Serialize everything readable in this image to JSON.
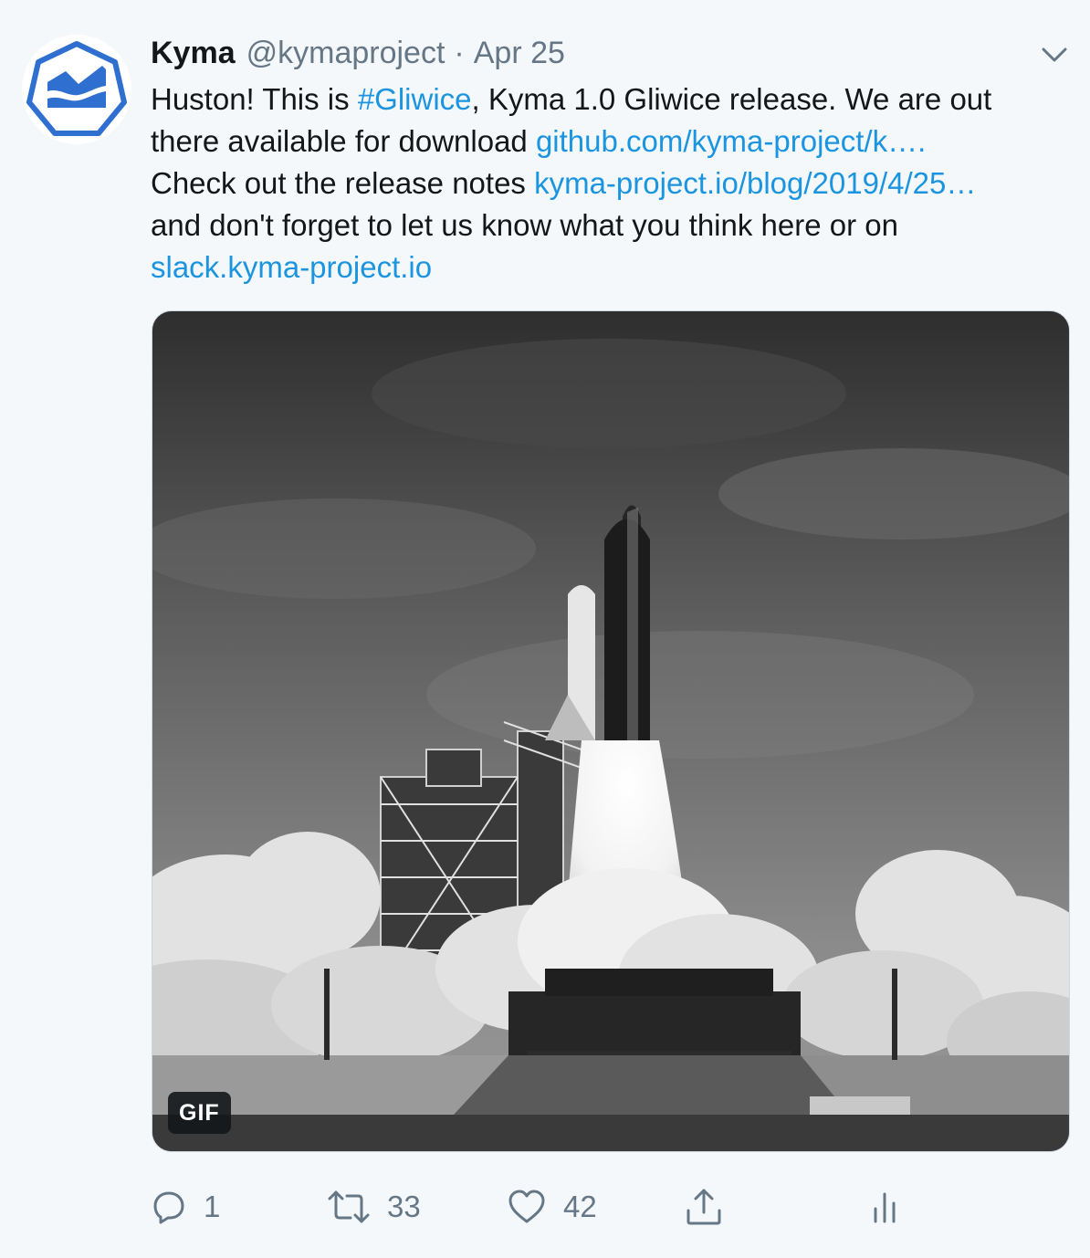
{
  "tweet": {
    "author_name": "Kyma",
    "author_handle": "@kymaproject",
    "separator": "·",
    "date": "Apr 25",
    "text": {
      "line1_a": "Huston! This is ",
      "hashtag": "#Gliwice",
      "line1_b": ", Kyma 1.0 Gliwice release. We are out",
      "line2_a": "there available for download ",
      "link_github": "github.com/kyma-project/k….",
      "line3_a": "Check out the release notes ",
      "link_blog": "kyma-project.io/blog/2019/4/25…",
      "line4": "and don't forget to let us know what you think here or on",
      "link_slack": "slack.kyma-project.io"
    },
    "media": {
      "badge": "GIF"
    },
    "actions": {
      "reply_count": "1",
      "retweet_count": "33",
      "like_count": "42"
    },
    "colors": {
      "link": "#1b95e0",
      "muted": "#657786",
      "brand_blue": "#2e6fcf"
    },
    "icons": [
      "kyma-logo-icon",
      "chevron-down-icon",
      "reply-icon",
      "retweet-icon",
      "like-icon",
      "share-icon",
      "analytics-icon"
    ]
  }
}
